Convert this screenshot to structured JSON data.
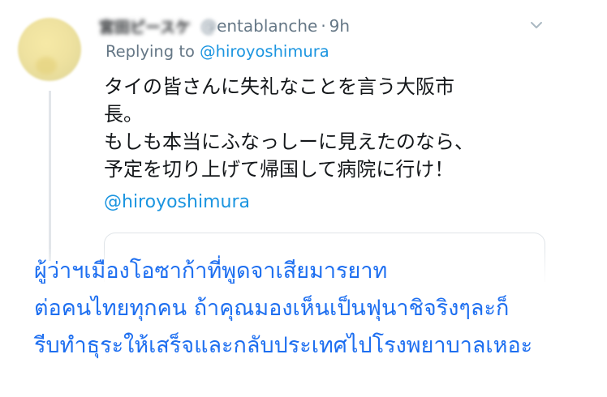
{
  "tweet": {
    "display_name": "宮田ピースケ",
    "handle_obscured": "@",
    "handle_visible": "entablanche",
    "separator": "·",
    "time": "9h",
    "reply_prefix": "Replying to",
    "reply_mention": "@hiroyoshimura",
    "body_lines": [
      "タイの皆さんに失礼なことを言う大阪市",
      "長。",
      "もしも本当にふなっしーに見えたのなら、",
      "予定を切り上げて帰国して病院に行け！"
    ],
    "mention_link": "@hiroyoshimura"
  },
  "overlay_caption": {
    "lines": [
      "ผู้ว่าฯเมืองโอซาก้าที่พูดจาเสียมารยาท",
      "ต่อคนไทยทุกคน ถ้าคุณมองเห็นเป็นฟุนาชิจริงๆละก็",
      "รีบทำธุระให้เสร็จและกลับประเทศไปโรงพยาบาลเหอะ"
    ]
  },
  "colors": {
    "link": "#1b95e0",
    "muted": "#657786",
    "text": "#14171a",
    "overlay_text": "#1e6ff0"
  },
  "icons": {
    "more_menu": "chevron-down-icon"
  }
}
